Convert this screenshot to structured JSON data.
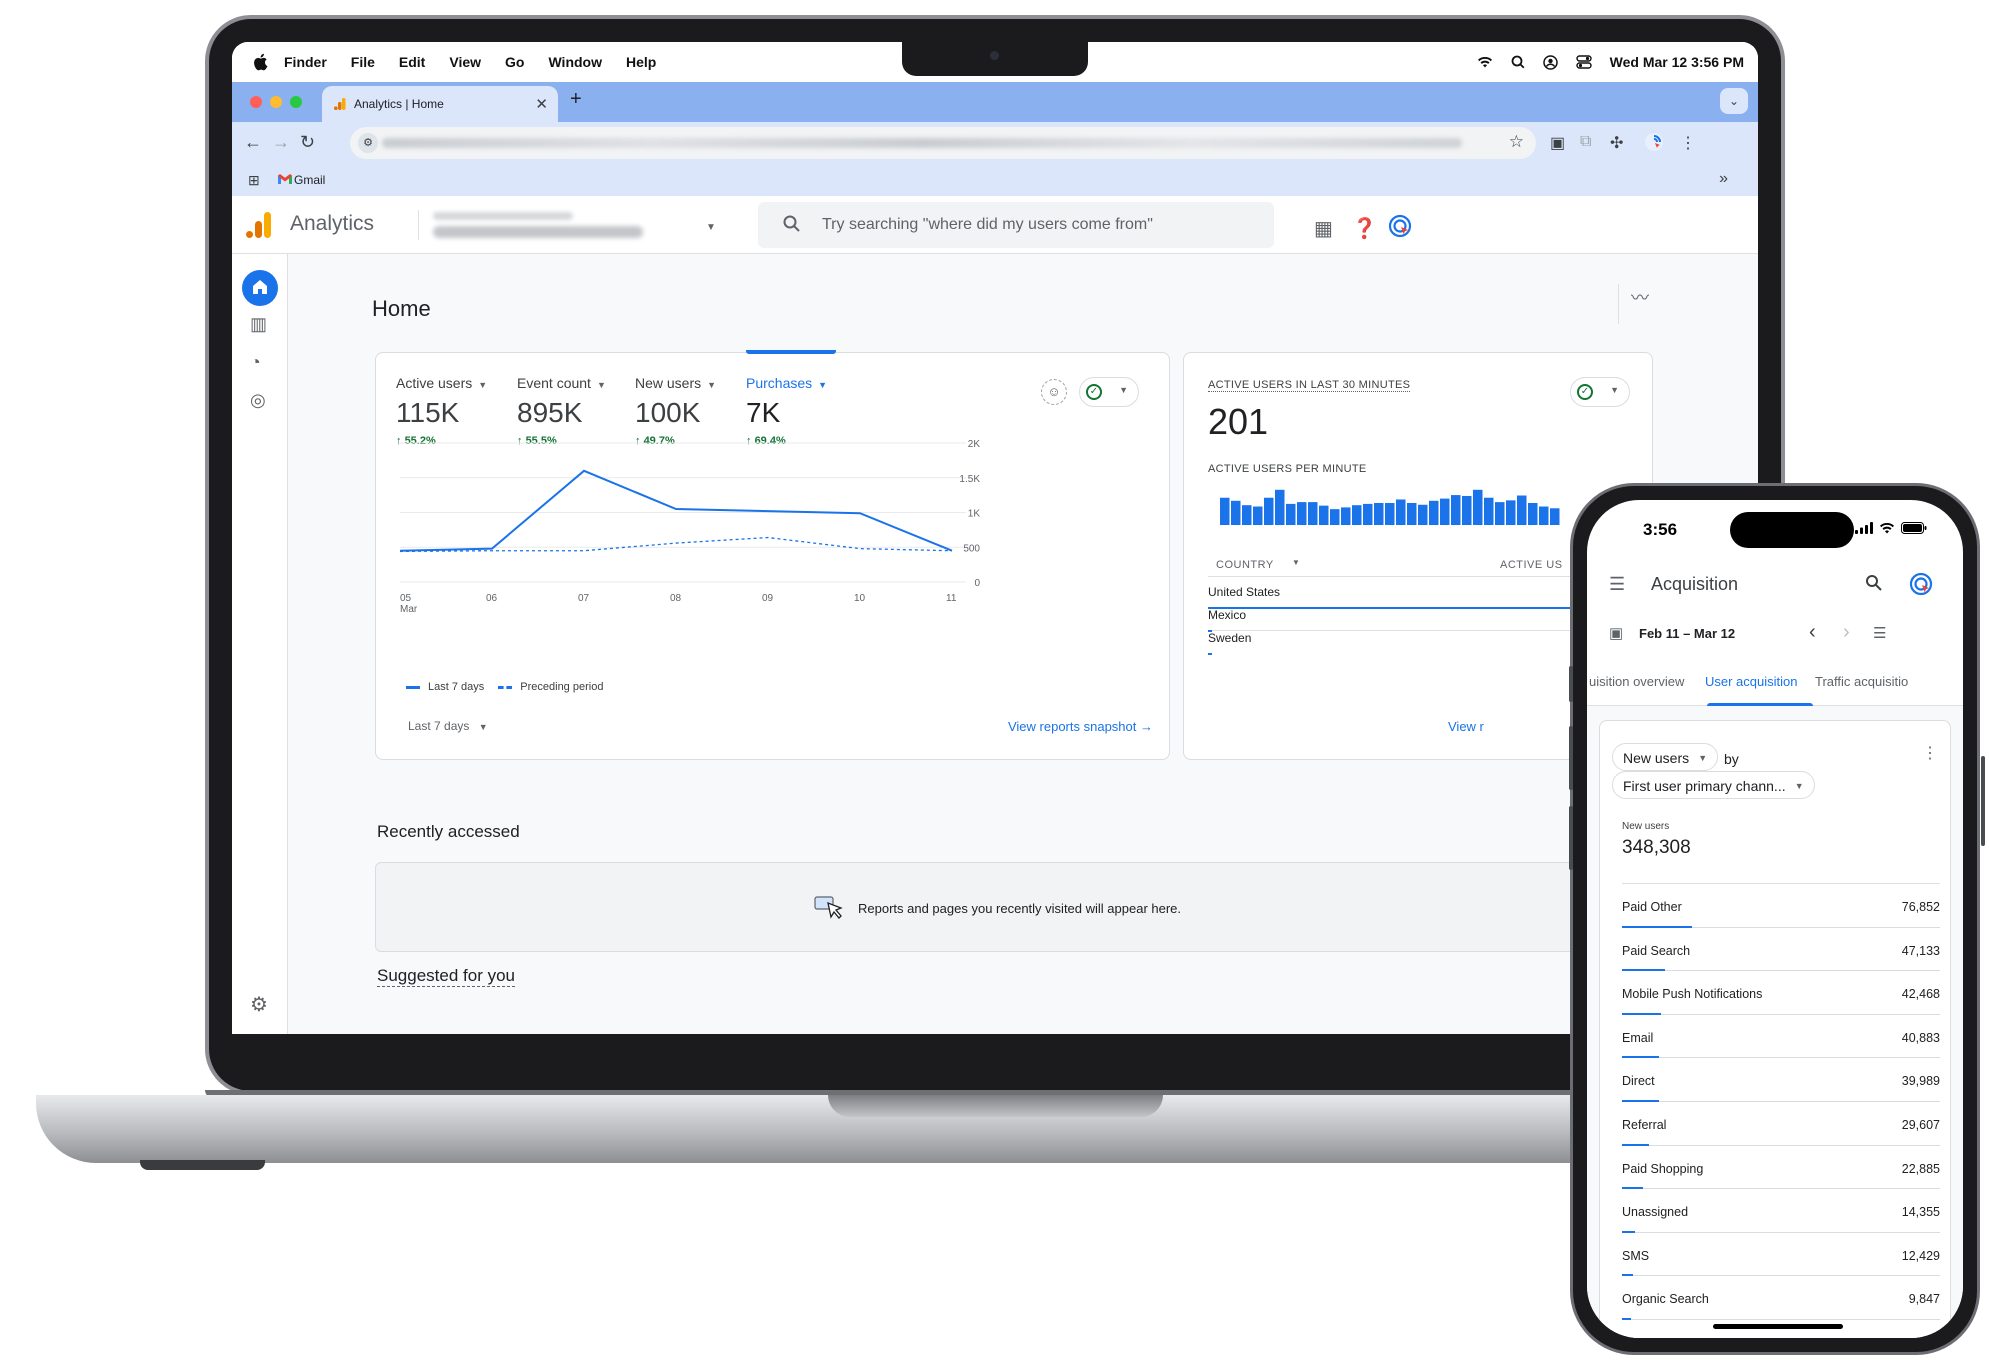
{
  "menubar": {
    "app": "Finder",
    "items": [
      "File",
      "Edit",
      "View",
      "Go",
      "Window",
      "Help"
    ],
    "clock": "Wed Mar 12  3:56 PM"
  },
  "browser": {
    "tab_title": "Analytics | Home",
    "bookmark": "Gmail"
  },
  "ga": {
    "product": "Analytics",
    "search_placeholder": "Try searching \"where did my users come from\"",
    "page_title": "Home",
    "metrics": [
      {
        "label": "Active users",
        "value": "115K",
        "delta": "55.2%"
      },
      {
        "label": "Event count",
        "value": "895K",
        "delta": "55.5%"
      },
      {
        "label": "New users",
        "value": "100K",
        "delta": "49.7%"
      },
      {
        "label": "Purchases",
        "value": "7K",
        "delta": "69.4%"
      }
    ],
    "legend_current": "Last 7 days",
    "legend_previous": "Preceding period",
    "period_selector": "Last 7 days",
    "view_reports": "View reports snapshot",
    "realtime": {
      "title": "ACTIVE USERS IN LAST 30 MINUTES",
      "value": "201",
      "per_minute": "ACTIVE USERS PER MINUTE",
      "col_country": "COUNTRY",
      "col_users": "ACTIVE US",
      "rows": [
        {
          "country": "United States",
          "share": 0.95
        },
        {
          "country": "Mexico",
          "share": 0.01
        },
        {
          "country": "Sweden",
          "share": 0.01
        }
      ],
      "view_link": "View r",
      "bars": [
        0.62,
        0.55,
        0.45,
        0.42,
        0.62,
        0.8,
        0.48,
        0.52,
        0.52,
        0.44,
        0.36,
        0.4,
        0.45,
        0.48,
        0.5,
        0.5,
        0.58,
        0.5,
        0.46,
        0.55,
        0.6,
        0.68,
        0.66,
        0.8,
        0.62,
        0.52,
        0.56,
        0.67,
        0.5,
        0.42,
        0.38
      ]
    },
    "recent_title": "Recently accessed",
    "recent_message": "Reports and pages you recently visited will appear here.",
    "suggested_title": "Suggested for you"
  },
  "chart_data": {
    "type": "line",
    "x": [
      "05 Mar",
      "06",
      "07",
      "08",
      "09",
      "10",
      "11"
    ],
    "y_ticks": [
      "2K",
      "1.5K",
      "1K",
      "500",
      "0"
    ],
    "ylim": [
      0,
      2000
    ],
    "series": [
      {
        "name": "Last 7 days",
        "values": [
          450,
          480,
          1600,
          1050,
          1020,
          990,
          450
        ]
      },
      {
        "name": "Preceding period",
        "values": [
          440,
          450,
          450,
          560,
          640,
          480,
          450
        ]
      }
    ]
  },
  "phone": {
    "time": "3:56",
    "title": "Acquisition",
    "date_range": "Feb 11 – Mar 12",
    "tabs": [
      "uisition overview",
      "User acquisition",
      "Traffic acquisitio"
    ],
    "metric_chip": "New users",
    "by": "by",
    "dimension_chip": "First user primary chann...",
    "total_label": "New users",
    "total": "348,308",
    "rows": [
      {
        "label": "Paid Other",
        "value": "76,852",
        "share": 0.22
      },
      {
        "label": "Paid Search",
        "value": "47,133",
        "share": 0.135
      },
      {
        "label": "Mobile Push Notifications",
        "value": "42,468",
        "share": 0.122
      },
      {
        "label": "Email",
        "value": "40,883",
        "share": 0.117
      },
      {
        "label": "Direct",
        "value": "39,989",
        "share": 0.115
      },
      {
        "label": "Referral",
        "value": "29,607",
        "share": 0.085
      },
      {
        "label": "Paid Shopping",
        "value": "22,885",
        "share": 0.066
      },
      {
        "label": "Unassigned",
        "value": "14,355",
        "share": 0.041
      },
      {
        "label": "SMS",
        "value": "12,429",
        "share": 0.036
      },
      {
        "label": "Organic Search",
        "value": "9,847",
        "share": 0.028
      }
    ]
  },
  "colors": {
    "accent": "#1a73e8",
    "positive": "#137333",
    "chrome_tabstrip": "#8ab0f0",
    "chrome_toolbar": "#dbe6fb"
  }
}
